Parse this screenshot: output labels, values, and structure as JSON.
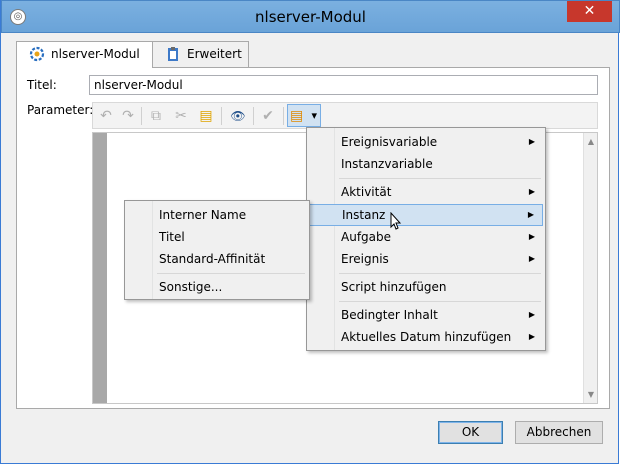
{
  "window": {
    "title": "nlserver-Modul",
    "close_glyph": "✕",
    "app_icon": "app-icon"
  },
  "tabs": [
    {
      "label": "nlserver-Modul",
      "icon": "gear-icon",
      "active": true
    },
    {
      "label": "Erweitert",
      "icon": "clipboard-icon",
      "active": false
    }
  ],
  "form": {
    "titel_label": "Titel:",
    "titel_value": "nlserver-Modul",
    "parameter_label": "Parameter:"
  },
  "toolbar": {
    "undo": "↶",
    "redo": "↷",
    "copy": "⧉",
    "cut": "✂",
    "paste": "▤",
    "find": "👁",
    "check": "✔",
    "insert_field": "▤",
    "dropdown": "▾"
  },
  "main_menu": [
    {
      "label": "Ereignisvariable",
      "submenu": true
    },
    {
      "label": "Instanzvariable",
      "submenu": false
    },
    {
      "label": "Aktivität",
      "submenu": true
    },
    {
      "label": "Instanz",
      "submenu": true,
      "highlighted": true
    },
    {
      "label": "Aufgabe",
      "submenu": true
    },
    {
      "label": "Ereignis",
      "submenu": true
    },
    {
      "label": "Script hinzufügen",
      "submenu": false
    },
    {
      "label": "Bedingter Inhalt",
      "submenu": true
    },
    {
      "label": "Aktuelles Datum hinzufügen",
      "submenu": true
    }
  ],
  "sub_menu": [
    {
      "label": "Interner Name"
    },
    {
      "label": "Titel"
    },
    {
      "label": "Standard-Affinität"
    },
    {
      "label": "Sonstige..."
    }
  ],
  "buttons": {
    "ok": "OK",
    "cancel": "Abbrechen"
  },
  "colors": {
    "titlebar": "#6fa8dc",
    "close": "#c7372c",
    "highlight": "#d1e2f2"
  }
}
